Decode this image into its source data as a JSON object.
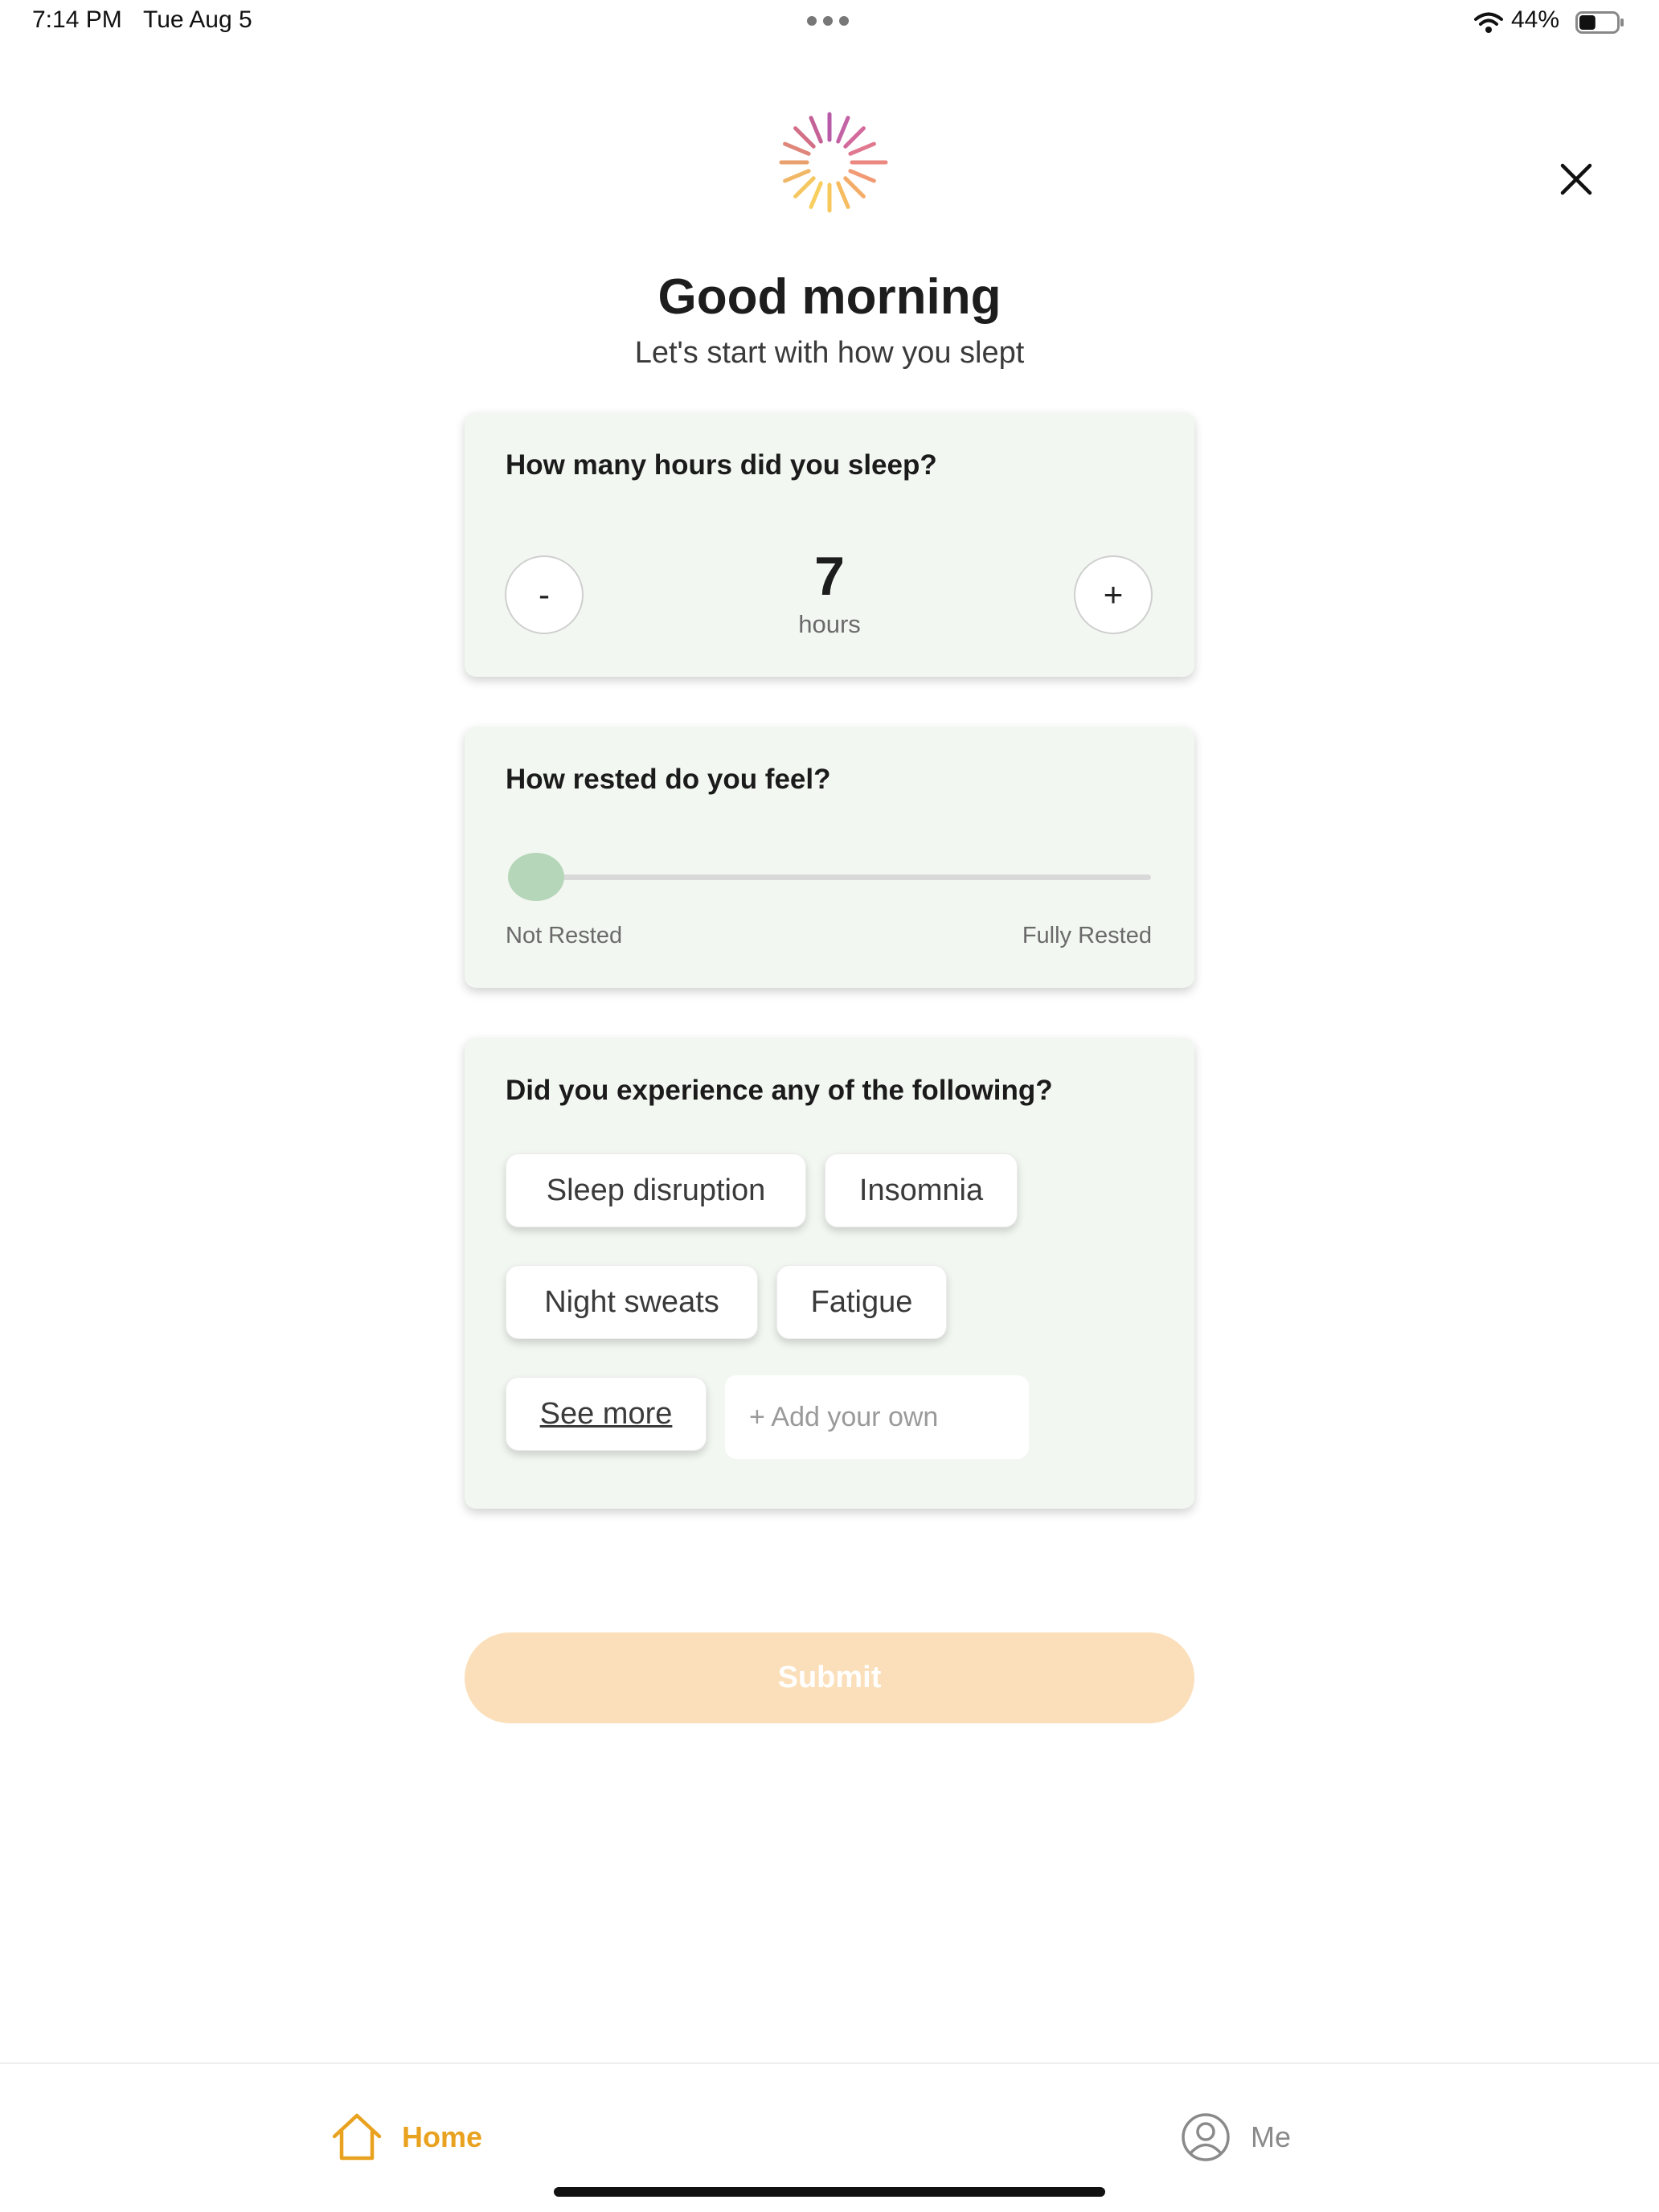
{
  "status_bar": {
    "time": "7:14 PM",
    "date": "Tue Aug 5",
    "battery_percent": "44%",
    "battery_level": 0.44,
    "icons": [
      "more-dots-icon",
      "wifi-icon",
      "battery-icon"
    ]
  },
  "header": {
    "logo_icon": "sunburst-logo-icon",
    "close_icon": "close-icon",
    "title": "Good morning",
    "subtitle": "Let's start with how you slept"
  },
  "sleep_hours": {
    "question": "How many hours did you sleep?",
    "decrement_label": "-",
    "increment_label": "+",
    "value": "7",
    "unit": "hours"
  },
  "rested": {
    "question": "How rested do you feel?",
    "min_label": "Not Rested",
    "max_label": "Fully Rested",
    "value": 0
  },
  "symptoms": {
    "question": "Did you experience any of the following?",
    "chips": [
      "Sleep disruption",
      "Insomnia",
      "Night sweats",
      "Fatigue"
    ],
    "see_more_label": "See more",
    "add_own_placeholder": "+ Add your own"
  },
  "submit": {
    "label": "Submit"
  },
  "tab_bar": {
    "home_label": "Home",
    "me_label": "Me"
  },
  "colors": {
    "accent": "#e9a21f",
    "card_background": "#f2f7f1",
    "submit_background": "#fbdfba",
    "slider_thumb": "#b5d6b9"
  }
}
